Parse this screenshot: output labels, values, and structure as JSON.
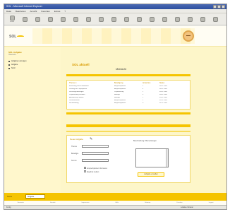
{
  "window": {
    "title": "SOL - Microsoft Internet Explorer"
  },
  "menu": [
    "Datei",
    "Bearbeiten",
    "Ansicht",
    "Favoriten",
    "Extras",
    "?"
  ],
  "toolbar": {
    "items": [
      {
        "label": "Zurück",
        "icon": "back-icon"
      },
      {
        "label": "",
        "icon": "forward-icon"
      },
      {
        "label": "",
        "icon": "stop-icon"
      },
      {
        "label": "",
        "icon": "refresh-icon"
      },
      {
        "label": "",
        "icon": "home-icon"
      },
      {
        "label": "",
        "icon": "search-icon"
      },
      {
        "label": "",
        "icon": "favorites-icon"
      },
      {
        "label": "",
        "icon": "history-icon"
      },
      {
        "label": "",
        "icon": "mail-icon"
      },
      {
        "label": "",
        "icon": "print-icon"
      },
      {
        "label": "",
        "icon": "edit-icon"
      },
      {
        "label": "",
        "icon": "discuss-icon"
      },
      {
        "label": "",
        "icon": "messenger-icon"
      },
      {
        "label": "",
        "icon": "research-icon"
      },
      {
        "label": "",
        "icon": "media-icon"
      },
      {
        "label": "",
        "icon": "tools-icon"
      },
      {
        "label": "",
        "icon": "help-icon"
      }
    ]
  },
  "header": {
    "logo": "SOL"
  },
  "sidebar": {
    "title": "SOL Aufgabe",
    "subtitle": "Übersicht",
    "items": [
      "Aufgaben anzeigen",
      "Aufgabe",
      "Notiz"
    ]
  },
  "content": {
    "title": "SOL aktuell",
    "subtitle": "Übersicht",
    "table": {
      "headers": [
        "Thema",
        "Beteiligung",
        "Antworten",
        "Status"
      ],
      "rows": [
        [
          "Einführung neuer Mitarbeiter",
          "Ansprechpartner",
          "2",
          "06.07.2003"
        ],
        [
          "Planung der Projektphase",
          "Ansprechpartner",
          "4",
          "06.07.2003"
        ],
        [
          "Schulungsunterlagen",
          "Projektleitung",
          "1",
          "05.07.2003"
        ],
        [
          "Projektauftrag erstellen",
          "Beteiligt",
          "3",
          "04.07.2003"
        ],
        [
          "Abstimmung Termine",
          "Beteiligt",
          "2",
          "03.07.2003"
        ],
        [
          "Dokumentation",
          "Ansprechpartner",
          "1",
          "02.07.2003"
        ],
        [
          "Rückmeldung",
          "Ansprechpartner",
          "0",
          "01.07.2003"
        ]
      ]
    },
    "form": {
      "title": "Neue Aufgabe",
      "labels": [
        "Thema",
        "Beteiligte",
        "Termin"
      ],
      "checkbox_1": "Ansprechpartner informieren",
      "checkbox_2": "Ergebnis melden",
      "right_title": "Beschreibung / Bemerkungen",
      "button": "Aufgabe erstellen"
    }
  },
  "bottom_bar": {
    "label": "Suche",
    "input_value": "Aufgabe"
  },
  "footer": {
    "links": [
      "Startseite",
      "Kontakt",
      "Impressum",
      "Hilfe",
      "Sitemap",
      "Drucken",
      "Logout"
    ]
  },
  "status": {
    "left": "Fertig",
    "right": "Lokales Intranet"
  },
  "colors": {
    "accent": "#f5c400",
    "page_bg": "#fdf6c9",
    "title_orange": "#d99b00"
  }
}
